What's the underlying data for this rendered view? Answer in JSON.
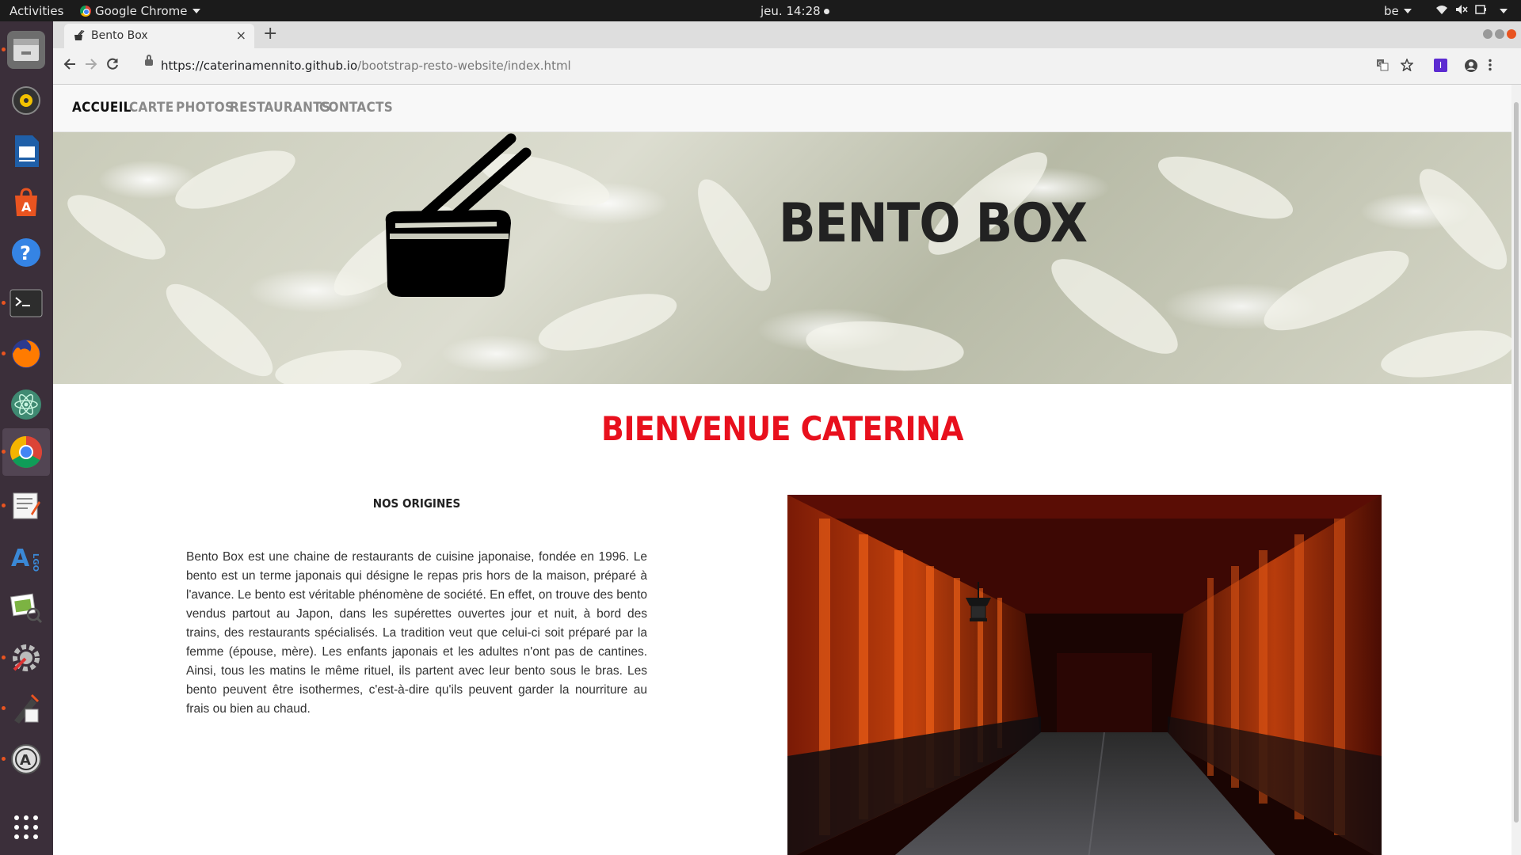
{
  "system_bar": {
    "activities": "Activities",
    "app_name": "Google Chrome",
    "clock": "jeu. 14:28",
    "keyboard_layout": "be"
  },
  "dock": {
    "items": [
      "files-icon",
      "rhythmbox-icon",
      "writer-icon",
      "software-center-icon",
      "help-icon",
      "terminal-icon",
      "firefox-icon",
      "atom-icon",
      "chrome-icon",
      "text-editor-icon",
      "algo-icon",
      "image-viewer-icon",
      "settings-tool-icon",
      "inkscape-icon",
      "software-updater-icon",
      "app-grid-icon"
    ]
  },
  "browser": {
    "tab_title": "Bento Box",
    "url_host": "https://caterinamennito.github.io",
    "url_path": "/bootstrap-resto-website/index.html"
  },
  "site": {
    "nav": [
      "Accueil",
      "Carte",
      "Photos",
      "Restaurants",
      "Contacts"
    ],
    "active_nav": "Accueil",
    "hero_title": "Bento Box",
    "welcome": "Bienvenue Caterina",
    "origins_heading": "Nos origines",
    "origins_text": "Bento Box est une chaine de restaurants de cuisine japonaise, fondée en 1996. Le bento est un terme japonais qui désigne le repas pris hors de la maison, préparé à l'avance. Le bento est véritable phénomène de société. En effet, on trouve des bento vendus partout au Japon, dans les supérettes ouvertes jour et nuit, à bord des trains, des restaurants spécialisés. La tradition veut que celui-ci soit préparé par la femme (épouse, mère). Les enfants japonais et les adultes n'ont pas de cantines. Ainsi, tous les matins le même rituel, ils partent avec leur bento sous le bras. Les bento peuvent être isothermes, c'est-à-dire qu'ils peuvent garder la nourriture au frais ou bien au chaud."
  },
  "colors": {
    "accent_red": "#e8101d",
    "torii_orange": "#c2410c",
    "dock_bg": "#3b2f3a"
  }
}
